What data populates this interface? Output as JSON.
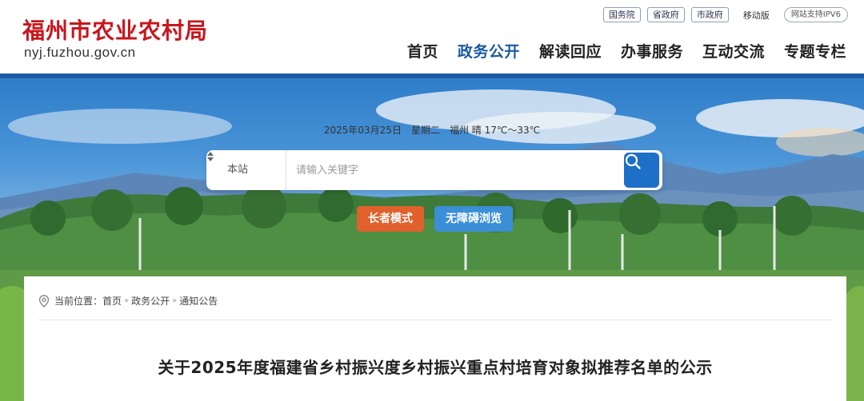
{
  "site": {
    "name_cn": "福州市农业农村局",
    "domain": "nyj.fuzhou.gov.cn"
  },
  "top_links": [
    "国务院",
    "省政府",
    "市政府"
  ],
  "mobile_label": "移动版",
  "ipv6_label": "网站支持IPV6",
  "nav": [
    {
      "label": "首页",
      "active": false
    },
    {
      "label": "政务公开",
      "active": true
    },
    {
      "label": "解读回应",
      "active": false
    },
    {
      "label": "办事服务",
      "active": false
    },
    {
      "label": "互动交流",
      "active": false
    },
    {
      "label": "专题专栏",
      "active": false
    }
  ],
  "info": {
    "date": "2025年03月25日",
    "weekday": "星期二",
    "weather": "福州 晴 17℃～33℃"
  },
  "search": {
    "scope": "本站",
    "placeholder": "请输入关键字"
  },
  "modes": {
    "elder": "长者模式",
    "accessible": "无障碍浏览"
  },
  "breadcrumb": {
    "prefix": "当前位置：",
    "items": [
      "首页",
      "政务公开",
      "通知公告"
    ]
  },
  "article": {
    "title": "关于2025年度福建省乡村振兴度乡村振兴重点村培育对象拟推荐名单的公示"
  },
  "colors": {
    "brand_red": "#c8161d",
    "nav_active": "#1a5aa0",
    "elder_btn": "#e0612c",
    "access_btn": "#3b8fd6",
    "search_btn": "#1e6fc7"
  }
}
